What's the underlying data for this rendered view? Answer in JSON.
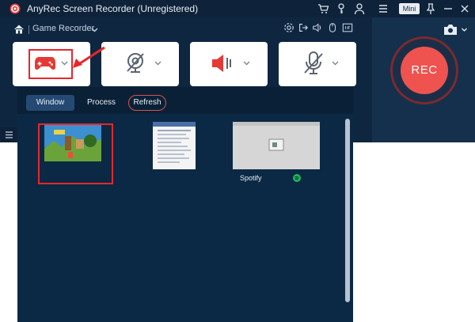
{
  "app": {
    "title": "AnyRec Screen Recorder (Unregistered)",
    "mini_label": "Mini",
    "accent": "#ef5350",
    "background": "#0f2640"
  },
  "toolbar": {
    "mode_label": "Game Recorder"
  },
  "record": {
    "rec_label": "REC"
  },
  "popup": {
    "tabs": {
      "window": "Window",
      "process": "Process",
      "refresh": "Refresh"
    },
    "items": [
      {
        "name": "",
        "kind": "game-window"
      },
      {
        "name": "",
        "kind": "document-window"
      },
      {
        "name": "Spotify",
        "kind": "spotify-window"
      }
    ]
  },
  "icons": [
    "app-logo-icon",
    "cart-icon",
    "key-icon",
    "user-icon",
    "menu-icon",
    "pin-icon",
    "minimize-icon",
    "close-icon",
    "home-icon",
    "chevron-down-icon",
    "settings-icon",
    "export-icon",
    "volume-icon",
    "mouse-icon",
    "fit-icon",
    "gamepad-icon",
    "webcam-off-icon",
    "speaker-icon",
    "mic-off-icon",
    "camera-icon",
    "spotify-icon",
    "list-icon"
  ]
}
